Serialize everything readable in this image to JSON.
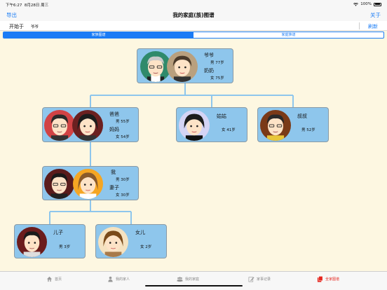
{
  "status_bar": {
    "time": "下午6:27",
    "date": "8月28日 周三",
    "battery": "100%"
  },
  "nav": {
    "export": "导出",
    "title": "我的家庭(族)图谱",
    "about": "关于"
  },
  "start": {
    "label": "开始于",
    "value": "爷爷",
    "refresh": "刷新"
  },
  "segments": {
    "tree": "家族图谱",
    "album": "家庭族谱"
  },
  "cards": {
    "grandparents": {
      "name1": "爷爷",
      "info1": "男 77岁",
      "name2": "奶奶",
      "info2": "女 75岁"
    },
    "parents": {
      "name1": "爸爸",
      "info1": "男 55岁",
      "name2": "妈妈",
      "info2": "女 54岁"
    },
    "aunt": {
      "name": "姑姑",
      "info": "女 41岁"
    },
    "uncle": {
      "name": "叔叔",
      "info": "男 52岁"
    },
    "me": {
      "name1": "我",
      "info1": "男 30岁",
      "name2": "妻子",
      "info2": "女 30岁"
    },
    "son": {
      "name": "儿子",
      "info": "男 3岁"
    },
    "daughter": {
      "name": "女儿",
      "info": "女 2岁"
    }
  },
  "tabs": [
    "首页",
    "我的家人",
    "我的家庭",
    "家事记录",
    "全家图谱"
  ],
  "colors": {
    "accent": "#1a7cf5",
    "card": "#8ec6ec",
    "background": "#fdf7e1",
    "active_tab": "#e5261e"
  }
}
